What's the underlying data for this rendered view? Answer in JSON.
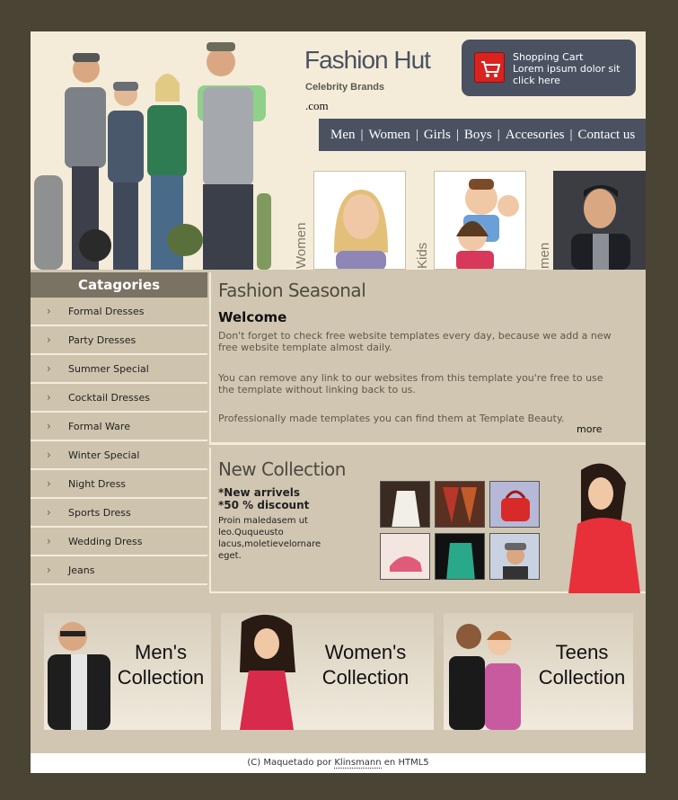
{
  "brand": {
    "title": "Fashion Hut",
    "subtitle": "Celebrity Brands",
    "domain": ".com"
  },
  "cart": {
    "line1": "Shopping Cart",
    "line2": "Lorem ipsum dolor sit",
    "line3": "click here"
  },
  "nav": {
    "items": [
      "Men",
      "Women",
      "Girls",
      "Boys",
      "Accesories",
      "Contact us"
    ]
  },
  "thumbs": {
    "women": "Women",
    "kids": "Kids",
    "men": "men"
  },
  "sidebar": {
    "title": "Catagories",
    "items": [
      "Formal Dresses",
      "Party Dresses",
      "Summer Special",
      "Cocktail Dresses",
      "Formal Ware",
      "Winter Special",
      "Night Dress",
      "Sports Dress",
      "Wedding Dress",
      "Jeans"
    ]
  },
  "seasonal": {
    "title": "Fashion Seasonal",
    "welcome": "Welcome",
    "p1": "Don't forget to check free website templates every day, because we add a new free website template almost daily.",
    "p2": "You can remove any link to our websites from this template you're free to use the template without linking back to us.",
    "p3": "Professionally made templates you can find them at Template Beauty.",
    "more": "more"
  },
  "newcollection": {
    "title": "New Collection",
    "tag1": "*New arrivels",
    "tag2": "*50 % discount",
    "desc": "Proin maledasem ut leo.Ququeusto lacus,moletievelornare eget."
  },
  "collections": {
    "men": {
      "l1": "Men's",
      "l2": "Collection"
    },
    "women": {
      "l1": "Women's",
      "l2": "Collection"
    },
    "teens": {
      "l1": "Teens",
      "l2": "Collection"
    }
  },
  "footer": {
    "prefix": "(C) Maquetado por ",
    "author": "Klinsmann",
    "suffix": " en HTML5"
  }
}
